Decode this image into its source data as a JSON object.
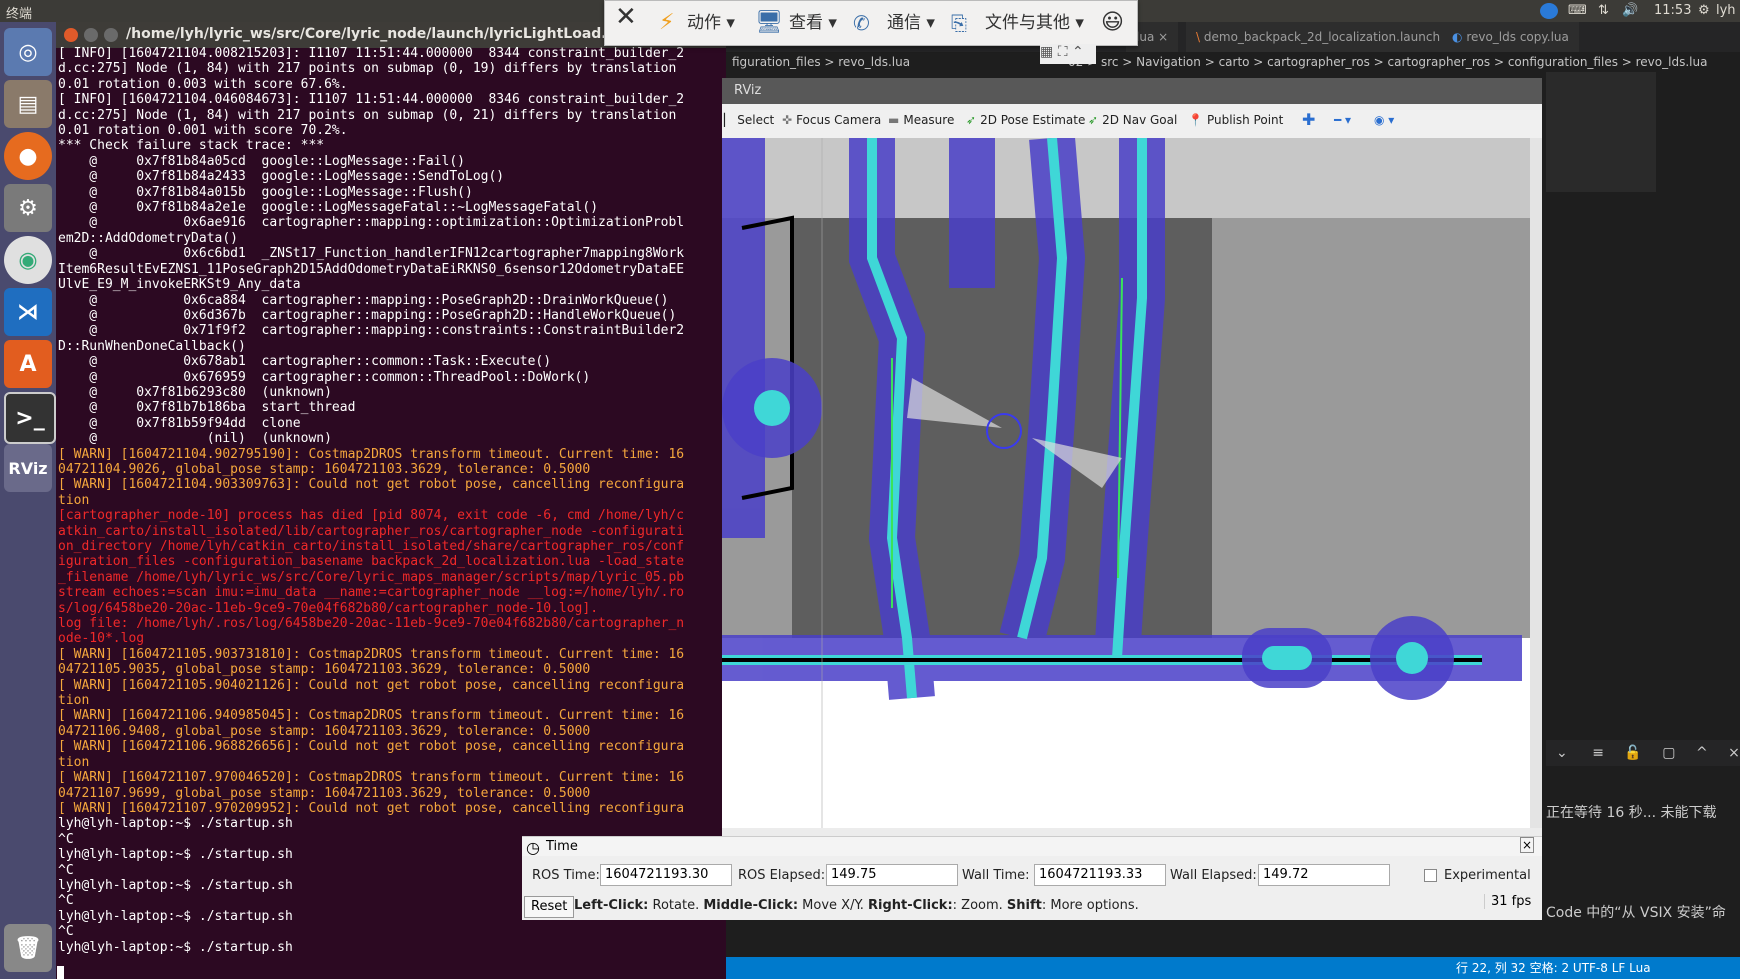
{
  "top_panel": {
    "app": "终端",
    "time": "11:53",
    "user": "lyh"
  },
  "terminal": {
    "title": "/home/lyh/lyric_ws/src/Core/lyric_node/launch/lyricLightLoad.launch ht",
    "lines": [
      {
        "t": "[ INFO] [1604721104.008215203]: I1107 11:51:44.000000  8344 constraint_builder_2",
        "c": ""
      },
      {
        "t": "d.cc:275] Node (1, 84) with 217 points on submap (0, 19) differs by translation",
        "c": ""
      },
      {
        "t": "0.01 rotation 0.003 with score 67.6%.",
        "c": ""
      },
      {
        "t": "[ INFO] [1604721104.046084673]: I1107 11:51:44.000000  8346 constraint_builder_2",
        "c": ""
      },
      {
        "t": "d.cc:275] Node (1, 84) with 217 points on submap (0, 21) differs by translation",
        "c": ""
      },
      {
        "t": "0.01 rotation 0.001 with score 70.2%.",
        "c": ""
      },
      {
        "t": "*** Check failure stack trace: ***",
        "c": ""
      },
      {
        "t": "    @     0x7f81b84a05cd  google::LogMessage::Fail()",
        "c": ""
      },
      {
        "t": "    @     0x7f81b84a2433  google::LogMessage::SendToLog()",
        "c": ""
      },
      {
        "t": "    @     0x7f81b84a015b  google::LogMessage::Flush()",
        "c": ""
      },
      {
        "t": "    @     0x7f81b84a2e1e  google::LogMessageFatal::~LogMessageFatal()",
        "c": ""
      },
      {
        "t": "    @           0x6ae916  cartographer::mapping::optimization::OptimizationProbl",
        "c": ""
      },
      {
        "t": "em2D::AddOdometryData()",
        "c": ""
      },
      {
        "t": "    @           0x6c6bd1  _ZNSt17_Function_handlerIFN12cartographer7mapping8Work",
        "c": ""
      },
      {
        "t": "Item6ResultEvEZNS1_11PoseGraph2D15AddOdometryDataEiRKNS0_6sensor12OdometryDataEE",
        "c": ""
      },
      {
        "t": "UlvE_E9_M_invokeERKSt9_Any_data",
        "c": ""
      },
      {
        "t": "    @           0x6ca884  cartographer::mapping::PoseGraph2D::DrainWorkQueue()",
        "c": ""
      },
      {
        "t": "    @           0x6d367b  cartographer::mapping::PoseGraph2D::HandleWorkQueue()",
        "c": ""
      },
      {
        "t": "    @           0x71f9f2  cartographer::mapping::constraints::ConstraintBuilder2",
        "c": ""
      },
      {
        "t": "D::RunWhenDoneCallback()",
        "c": ""
      },
      {
        "t": "    @           0x678ab1  cartographer::common::Task::Execute()",
        "c": ""
      },
      {
        "t": "    @           0x676959  cartographer::common::ThreadPool::DoWork()",
        "c": ""
      },
      {
        "t": "    @     0x7f81b6293c80  (unknown)",
        "c": ""
      },
      {
        "t": "    @     0x7f81b7b186ba  start_thread",
        "c": ""
      },
      {
        "t": "    @     0x7f81b59f94dd  clone",
        "c": ""
      },
      {
        "t": "    @              (nil)  (unknown)",
        "c": ""
      },
      {
        "t": "[ WARN] [1604721104.902795190]: Costmap2DROS transform timeout. Current time: 16",
        "c": "warn"
      },
      {
        "t": "04721104.9026, global_pose stamp: 1604721103.3629, tolerance: 0.5000",
        "c": "warn"
      },
      {
        "t": "[ WARN] [1604721104.903309763]: Could not get robot pose, cancelling reconfigura",
        "c": "warn"
      },
      {
        "t": "tion",
        "c": "warn"
      },
      {
        "t": "[cartographer_node-10] process has died [pid 8074, exit code -6, cmd /home/lyh/c",
        "c": "err"
      },
      {
        "t": "atkin_carto/install_isolated/lib/cartographer_ros/cartographer_node -configurati",
        "c": "err"
      },
      {
        "t": "on_directory /home/lyh/catkin_carto/install_isolated/share/cartographer_ros/conf",
        "c": "err"
      },
      {
        "t": "iguration_files -configuration_basename backpack_2d_localization.lua -load_state",
        "c": "err"
      },
      {
        "t": "_filename /home/lyh/lyric_ws/src/Core/lyric_maps_manager/scripts/map/lyric_05.pb",
        "c": "err"
      },
      {
        "t": "stream echoes:=scan imu:=imu_data __name:=cartographer_node __log:=/home/lyh/.ro",
        "c": "err"
      },
      {
        "t": "s/log/6458be20-20ac-11eb-9ce9-70e04f682b80/cartographer_node-10.log].",
        "c": "err"
      },
      {
        "t": "log file: /home/lyh/.ros/log/6458be20-20ac-11eb-9ce9-70e04f682b80/cartographer_n",
        "c": "err"
      },
      {
        "t": "ode-10*.log",
        "c": "err"
      },
      {
        "t": "[ WARN] [1604721105.903731810]: Costmap2DROS transform timeout. Current time: 16",
        "c": "warn"
      },
      {
        "t": "04721105.9035, global_pose stamp: 1604721103.3629, tolerance: 0.5000",
        "c": "warn"
      },
      {
        "t": "[ WARN] [1604721105.904021126]: Could not get robot pose, cancelling reconfigura",
        "c": "warn"
      },
      {
        "t": "tion",
        "c": "warn"
      },
      {
        "t": "[ WARN] [1604721106.940985045]: Costmap2DROS transform timeout. Current time: 16",
        "c": "warn"
      },
      {
        "t": "04721106.9408, global_pose stamp: 1604721103.3629, tolerance: 0.5000",
        "c": "warn"
      },
      {
        "t": "[ WARN] [1604721106.968826656]: Could not get robot pose, cancelling reconfigura",
        "c": "warn"
      },
      {
        "t": "tion",
        "c": "warn"
      },
      {
        "t": "[ WARN] [1604721107.970046520]: Costmap2DROS transform timeout. Current time: 16",
        "c": "warn"
      },
      {
        "t": "04721107.9699, global_pose stamp: 1604721103.3629, tolerance: 0.5000",
        "c": "warn"
      },
      {
        "t": "[ WARN] [1604721107.970209952]: Could not get robot pose, cancelling reconfigura",
        "c": "warn"
      },
      {
        "t": "lyh@lyh-laptop:~$ ./startup.sh",
        "c": ""
      },
      {
        "t": "^C",
        "c": ""
      },
      {
        "t": "lyh@lyh-laptop:~$ ./startup.sh",
        "c": ""
      },
      {
        "t": "^C",
        "c": ""
      },
      {
        "t": "lyh@lyh-laptop:~$ ./startup.sh",
        "c": ""
      },
      {
        "t": "^C",
        "c": ""
      },
      {
        "t": "lyh@lyh-laptop:~$ ./startup.sh",
        "c": ""
      },
      {
        "t": "^C",
        "c": ""
      },
      {
        "t": "lyh@lyh-laptop:~$ ./startup.sh",
        "c": ""
      }
    ]
  },
  "menu": {
    "action": "动作",
    "view": "查看",
    "comm": "通信",
    "files": "文件与其他"
  },
  "vscode": {
    "tab1": "lua",
    "tab2": "demo_backpack_2d_localization.launch",
    "tab3": "revo_lds copy.lua",
    "crumb_left": "figuration_files  >  revo_lds.lua",
    "crumb_right": "02  >  src  >  Navigation  >  carto  >  cartographer_ros  >  cartographer_ros  >  configuration_files  >  revo_lds.lua",
    "side_text": "正在等待 16 秒... 未能下载",
    "side_text2": "Code 中的“从 VSIX 安装”命",
    "status": "行 22, 列 32    空格: 2    UTF-8    LF    Lua"
  },
  "rviz": {
    "title": "RViz",
    "tools": {
      "select": "Select",
      "focus": "Focus Camera",
      "measure": "Measure",
      "pose": "2D Pose Estimate",
      "goal": "2D Nav Goal",
      "publish": "Publish Point"
    },
    "time": {
      "header": "Time",
      "ros_time_label": "ROS Time:",
      "ros_time": "1604721193.30",
      "ros_elapsed_label": "ROS Elapsed:",
      "ros_elapsed": "149.75",
      "wall_time_label": "Wall Time:",
      "wall_time": "1604721193.33",
      "wall_elapsed_label": "Wall Elapsed:",
      "wall_elapsed": "149.72",
      "experimental": "Experimental",
      "reset": "Reset",
      "help_b1": "Left-Click:",
      "help_t1": " Rotate. ",
      "help_b2": "Middle-Click:",
      "help_t2": " Move X/Y. ",
      "help_b3": "Right-Click:",
      "help_t3": ": Zoom. ",
      "help_b4": "Shift",
      "help_t4": ": More options.",
      "fps": "31 fps"
    }
  }
}
